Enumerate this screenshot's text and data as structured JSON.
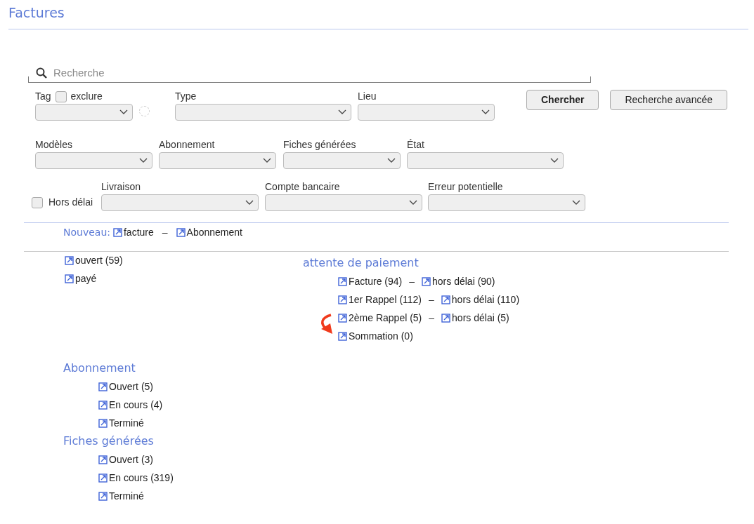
{
  "page": {
    "title": "Factures"
  },
  "search": {
    "placeholder": "Recherche"
  },
  "filters": [
    [
      {
        "kind": "select",
        "label": "Tag",
        "checkbox": {
          "label": "exclure",
          "checked": false
        }
      },
      {
        "kind": "select",
        "label": "Type"
      },
      {
        "kind": "select",
        "label": "Lieu"
      }
    ],
    [
      {
        "kind": "select",
        "label": "Modèles"
      },
      {
        "kind": "select",
        "label": "Abonnement"
      },
      {
        "kind": "select",
        "label": "Fiches générées"
      },
      {
        "kind": "select",
        "label": "État"
      }
    ],
    [
      {
        "kind": "checkbox",
        "label": "Hors délai",
        "checked": false
      },
      {
        "kind": "select",
        "label": "Livraison"
      },
      {
        "kind": "select",
        "label": "Compte bancaire"
      },
      {
        "kind": "select",
        "label": "Erreur potentielle"
      }
    ]
  ],
  "buttons": [
    {
      "label": "Chercher",
      "default": true
    },
    {
      "label": "Recherche avancée",
      "default": false
    }
  ],
  "nouveau": {
    "label": "Nouveau:",
    "links": [
      "facture",
      "Abonnement"
    ],
    "separator": "–"
  },
  "status_links": [
    "ouvert (59)",
    "payé"
  ],
  "attente": {
    "title": "attente de paiement",
    "rows": [
      [
        "Facture (94)",
        "hors délai (90)"
      ],
      [
        "1er Rappel (112)",
        "hors délai (110)"
      ],
      [
        "2ème Rappel (5)",
        "hors délai (5)"
      ],
      [
        "Sommation (0)"
      ]
    ],
    "separator": "–"
  },
  "sections": [
    {
      "title": "Abonnement",
      "links": [
        "Ouvert (5)",
        "En cours (4)",
        "Terminé"
      ]
    },
    {
      "title": "Fiches générées",
      "links": [
        "Ouvert (3)",
        "En cours (319)",
        "Terminé"
      ]
    }
  ]
}
